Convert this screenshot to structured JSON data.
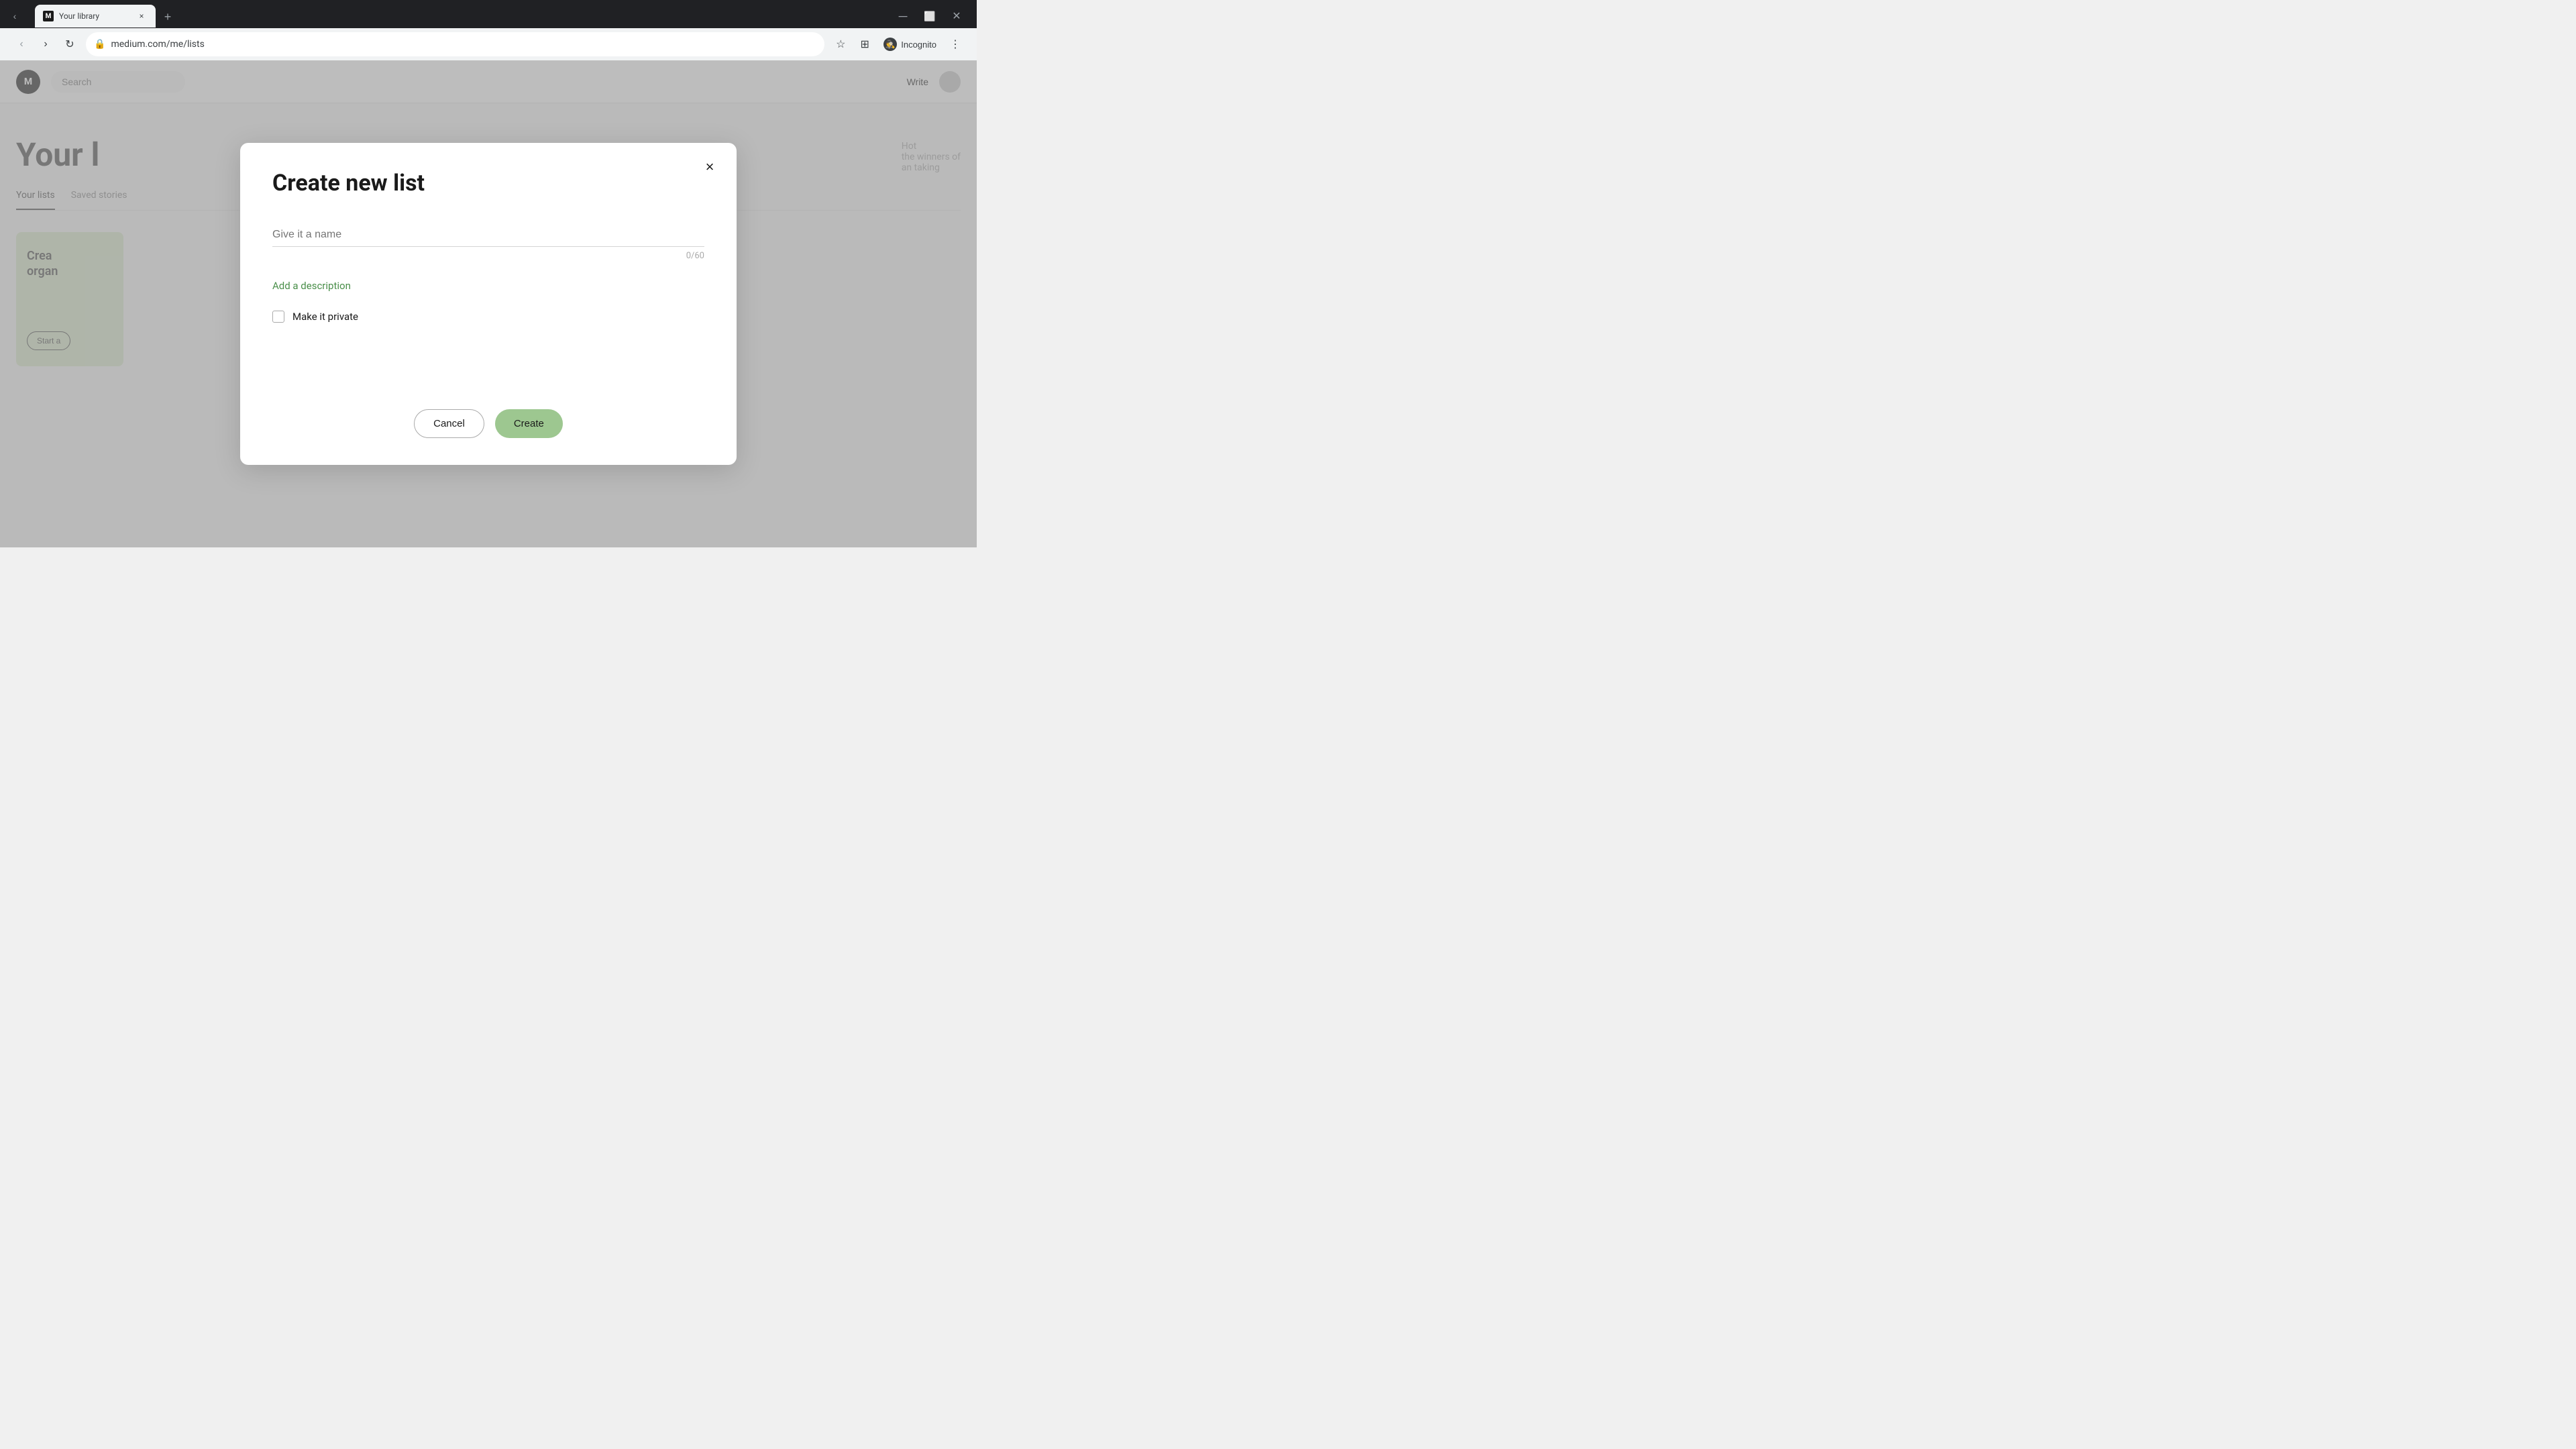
{
  "browser": {
    "tab": {
      "favicon_label": "M",
      "title": "Your library",
      "close_label": "×",
      "new_tab_label": "+"
    },
    "nav": {
      "back_label": "‹",
      "forward_label": "›",
      "reload_label": "↻"
    },
    "address": {
      "lock_icon": "🔒",
      "url": "medium.com/me/lists"
    },
    "toolbar": {
      "bookmark_label": "☆",
      "extensions_label": "⊞",
      "incognito_label": "Incognito",
      "menu_label": "⋮"
    }
  },
  "medium": {
    "nav": {
      "search_placeholder": "Search",
      "write_label": "Write",
      "avatar_initials": ""
    },
    "page": {
      "title": "Your library",
      "tabs": [
        {
          "label": "Your lists",
          "active": true
        },
        {
          "label": "Saved stories"
        }
      ],
      "create_card": {
        "line1": "Crea",
        "line2": "organ",
        "start_label": "Start a"
      }
    }
  },
  "modal": {
    "close_label": "×",
    "title": "Create new list",
    "name_placeholder": "Give it a name",
    "char_count": "0/60",
    "add_description_label": "Add a description",
    "make_private_label": "Make it private",
    "cancel_label": "Cancel",
    "create_label": "Create"
  },
  "background": {
    "right_text_1": "Hot",
    "right_text_2": "the winners of",
    "right_text_3": "an taking"
  }
}
